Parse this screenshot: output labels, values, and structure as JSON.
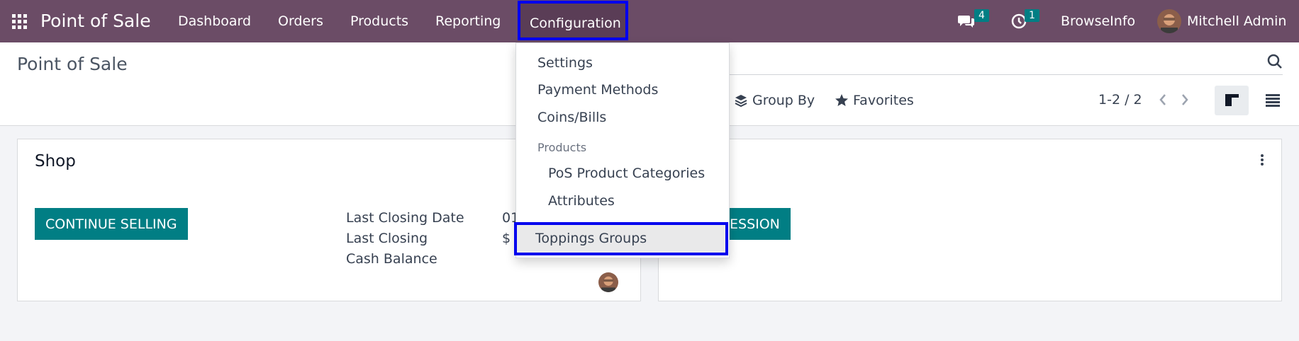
{
  "navbar": {
    "app_name": "Point of Sale",
    "menu": [
      "Dashboard",
      "Orders",
      "Products",
      "Reporting",
      "Configuration"
    ],
    "messages_count": "4",
    "activities_count": "1",
    "company": "BrowseInfo",
    "user": "Mitchell Admin"
  },
  "control_panel": {
    "title": "Point of Sale",
    "group_by": "Group By",
    "favorites": "Favorites",
    "pager": "1-2 / 2"
  },
  "configuration_menu": {
    "items": [
      "Settings",
      "Payment Methods",
      "Coins/Bills"
    ],
    "section_header": "Products",
    "sub_items": [
      "PoS Product Categories",
      "Attributes"
    ],
    "highlighted_item": "Toppings Groups"
  },
  "cards": [
    {
      "name": "Shop",
      "button": "CONTINUE SELLING",
      "fields": [
        "Last Closing Date",
        "Last Closing",
        "Cash Balance"
      ],
      "values": [
        "01",
        "$"
      ]
    },
    {
      "button_fragment": "ESSION"
    }
  ],
  "colors": {
    "navbar": "#6b4c66",
    "accent": "#017e84",
    "highlight_border": "#0000ee"
  }
}
